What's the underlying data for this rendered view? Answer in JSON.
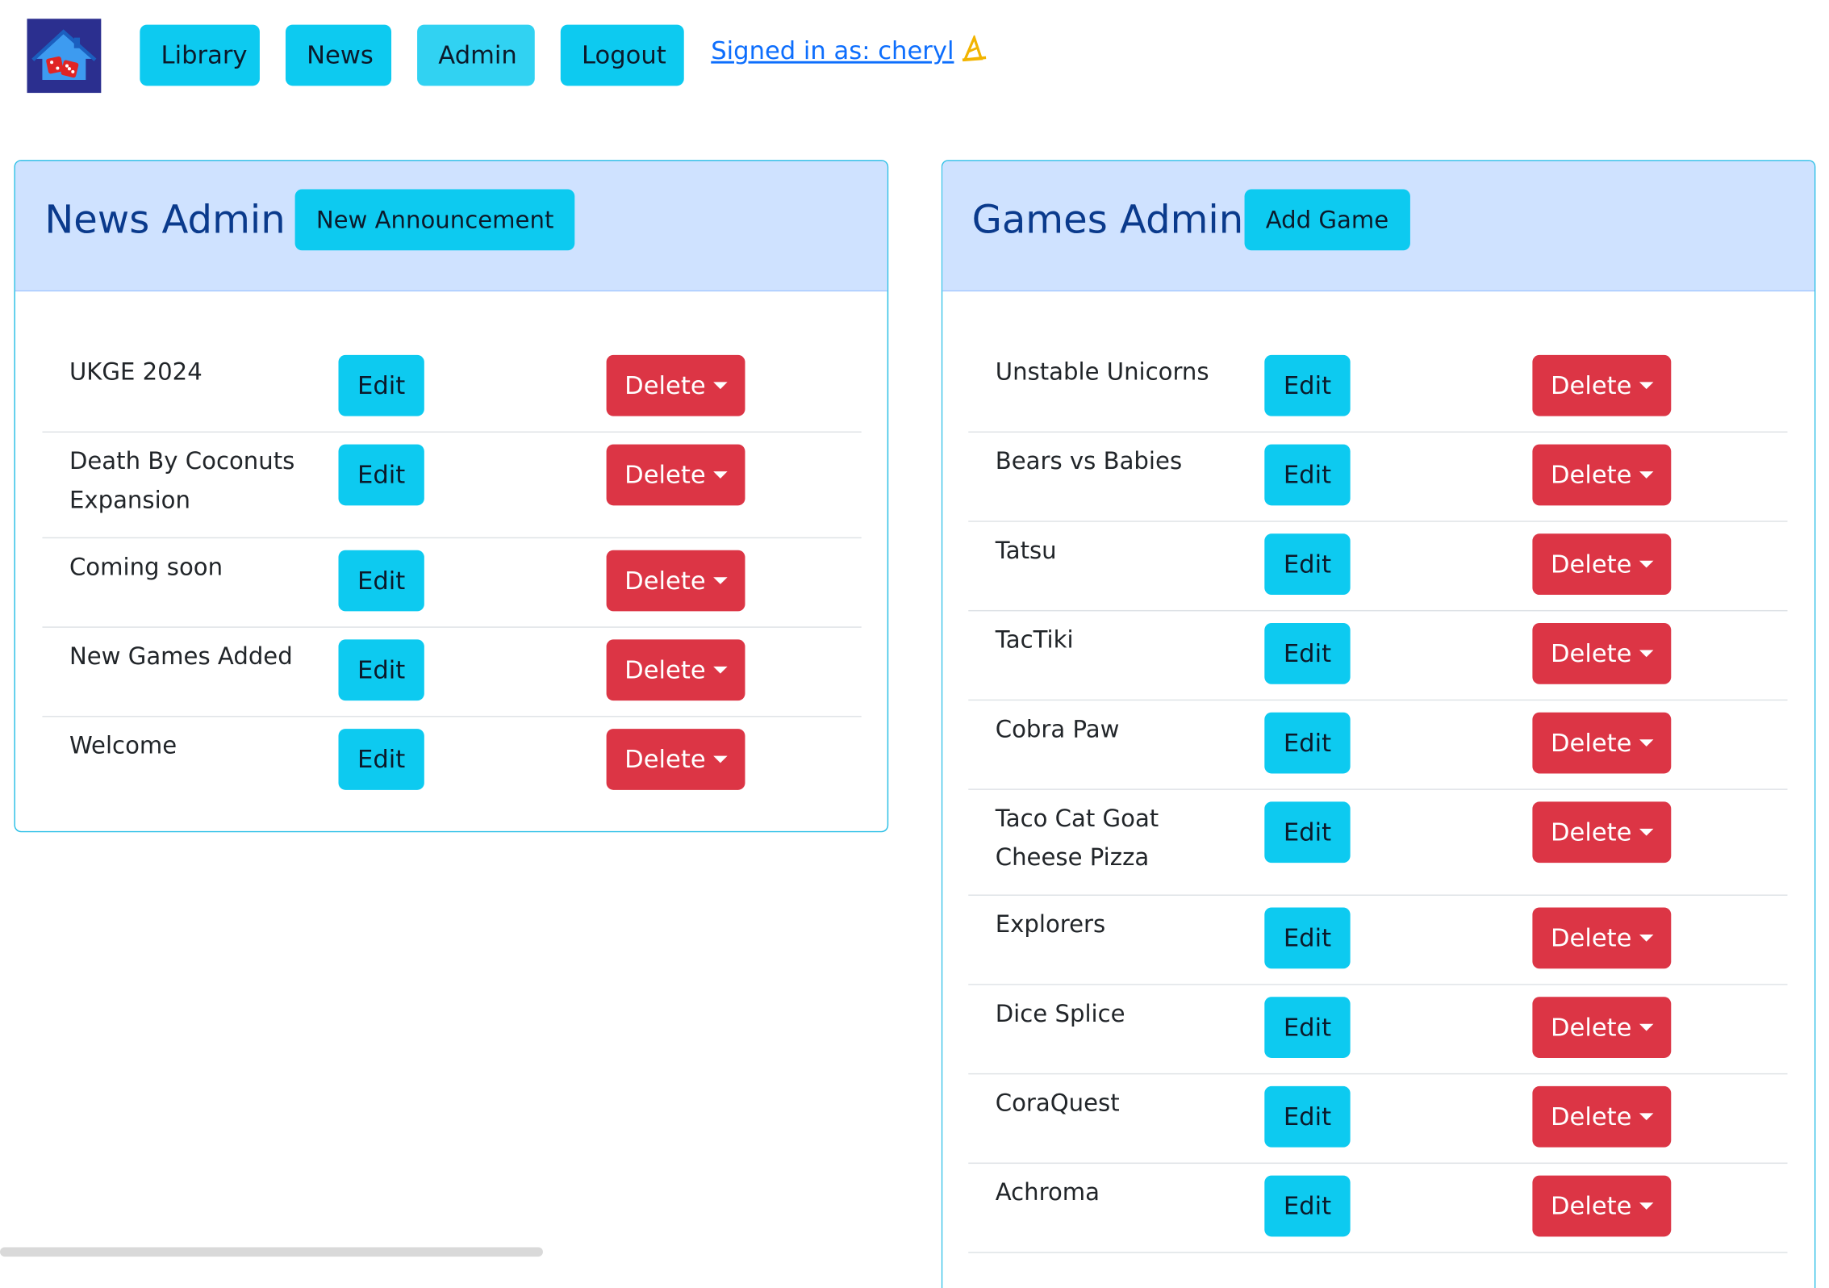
{
  "header": {
    "nav": [
      "Library",
      "News",
      "Admin",
      "Logout"
    ],
    "active_nav": "Admin",
    "signed_in": "Signed in as: cheryl",
    "signed_in_icon": "wizard-hat-icon"
  },
  "news_admin": {
    "title": "News Admin",
    "action_label": "New Announcement",
    "edit_label": "Edit",
    "delete_label": "Delete",
    "items": [
      "UKGE 2024",
      "Death By Coconuts Expansion",
      "Coming soon",
      "New Games Added",
      "Welcome"
    ]
  },
  "games_admin": {
    "title": "Games Admin",
    "action_label": "Add Game",
    "edit_label": "Edit",
    "delete_label": "Delete",
    "items": [
      "Unstable Unicorns",
      "Bears vs Babies",
      "Tatsu",
      "TacTiki",
      "Cobra Paw",
      "Taco Cat Goat Cheese Pizza",
      "Explorers",
      "Dice Splice",
      "CoraQuest",
      "Achroma"
    ]
  },
  "colors": {
    "info": "#0dcaf0",
    "danger": "#dc3545",
    "panel_header": "#cfe2ff",
    "title": "#0a3a8c",
    "link": "#0d6efd"
  }
}
